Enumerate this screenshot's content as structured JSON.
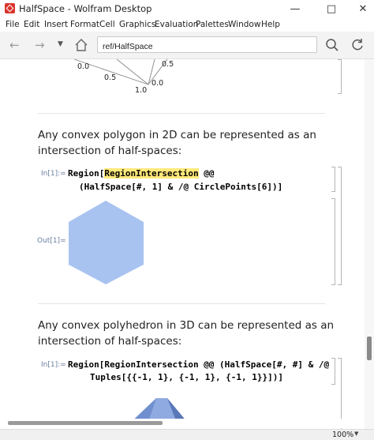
{
  "window": {
    "title": "HalfSpace - Wolfram Desktop"
  },
  "menu": [
    "File",
    "Edit",
    "Insert",
    "Format",
    "Cell",
    "Graphics",
    "Evaluation",
    "Palettes",
    "Window",
    "Help"
  ],
  "address": {
    "value": "ref/HalfSpace"
  },
  "plot_labels": [
    "0.5",
    "0.0",
    "0.5",
    "0.0",
    "1.0"
  ],
  "cells": {
    "text1_line1": "Any convex polygon in 2D can be represented as an",
    "text1_line2": "intersection of half-spaces:",
    "in1_label": "In[1]:=",
    "code1_a": "Region[",
    "code1_hl": "RegionIntersection",
    "code1_b": " @@",
    "code1_line2": "(HalfSpace[#, 1] & /@ CirclePoints[6])]",
    "out1_label": "Out[1]=",
    "text2_line1": "Any convex polyhedron in 3D can be represented as an",
    "text2_line2": "intersection of half-spaces:",
    "in2_label": "In[1]:=",
    "code2_line1": "Region[RegionIntersection @@ (HalfSpace[#, #] & /@",
    "code2_line2": "Tuples[{{-1, 1}, {-1, 1}, {-1, 1}}])]"
  },
  "status": {
    "zoom": "100%"
  },
  "colors": {
    "hexagon": "#a8c3f0",
    "highlight": "#ffe97a",
    "polyhedron": "#6f8fcf"
  }
}
